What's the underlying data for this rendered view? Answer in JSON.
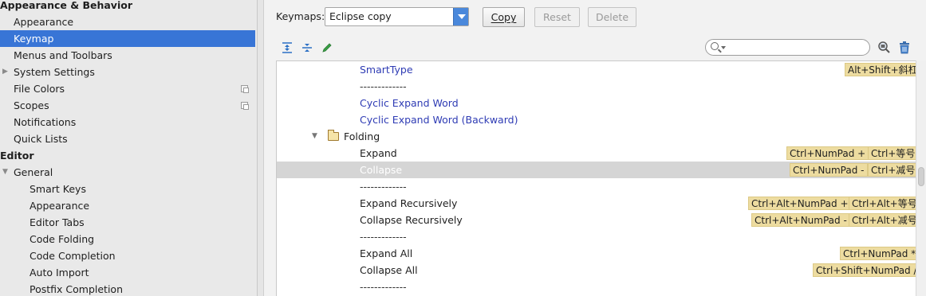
{
  "sidebar": {
    "items": [
      {
        "label": "Appearance & Behavior",
        "header": true,
        "arrow": "",
        "indent": 0,
        "copy": false
      },
      {
        "label": "Appearance",
        "header": false,
        "arrow": "",
        "indent": 17,
        "copy": false
      },
      {
        "label": "Keymap",
        "header": false,
        "arrow": "",
        "indent": 17,
        "copy": false,
        "selected": true
      },
      {
        "label": "Menus and Toolbars",
        "header": false,
        "arrow": "",
        "indent": 17,
        "copy": false
      },
      {
        "label": "System Settings",
        "header": false,
        "arrow": "▶",
        "indent": 17,
        "copy": false
      },
      {
        "label": "File Colors",
        "header": false,
        "arrow": "",
        "indent": 17,
        "copy": true
      },
      {
        "label": "Scopes",
        "header": false,
        "arrow": "",
        "indent": 17,
        "copy": true
      },
      {
        "label": "Notifications",
        "header": false,
        "arrow": "",
        "indent": 17,
        "copy": false
      },
      {
        "label": "Quick Lists",
        "header": false,
        "arrow": "",
        "indent": 17,
        "copy": false
      },
      {
        "label": "Editor",
        "header": true,
        "arrow": "",
        "indent": 0,
        "copy": false
      },
      {
        "label": "General",
        "header": false,
        "arrow": "▼",
        "indent": 17,
        "copy": false
      },
      {
        "label": "Smart Keys",
        "header": false,
        "arrow": "",
        "indent": 37,
        "copy": false
      },
      {
        "label": "Appearance",
        "header": false,
        "arrow": "",
        "indent": 37,
        "copy": false
      },
      {
        "label": "Editor Tabs",
        "header": false,
        "arrow": "",
        "indent": 37,
        "copy": false
      },
      {
        "label": "Code Folding",
        "header": false,
        "arrow": "",
        "indent": 37,
        "copy": false
      },
      {
        "label": "Code Completion",
        "header": false,
        "arrow": "",
        "indent": 37,
        "copy": false
      },
      {
        "label": "Auto Import",
        "header": false,
        "arrow": "",
        "indent": 37,
        "copy": false
      },
      {
        "label": "Postfix Completion",
        "header": false,
        "arrow": "",
        "indent": 37,
        "copy": false
      }
    ]
  },
  "toolbar": {
    "keymaps_label": "Keymaps:",
    "keymap_selected": "Eclipse copy",
    "copy_label": "Copy",
    "reset_label": "Reset",
    "delete_label": "Delete",
    "search_value": "",
    "icons": [
      "expand-all-icon",
      "collapse-all-icon",
      "edit-pencil-icon",
      "find-shortcut-icon",
      "trash-icon"
    ]
  },
  "tree": {
    "rows": [
      {
        "name": "SmartType",
        "kind": "action",
        "shortcuts": [
          "Alt+Shift+斜杠"
        ]
      },
      {
        "name": "-------------",
        "kind": "separator",
        "shortcuts": []
      },
      {
        "name": "Cyclic Expand Word",
        "kind": "action",
        "shortcuts": []
      },
      {
        "name": "Cyclic Expand Word (Backward)",
        "kind": "action",
        "shortcuts": []
      },
      {
        "name": "Folding",
        "kind": "group",
        "shortcuts": []
      },
      {
        "name": "Expand",
        "kind": "item",
        "shortcuts": [
          "Ctrl+NumPad +",
          "Ctrl+等号"
        ]
      },
      {
        "name": "Collapse",
        "kind": "item",
        "selected": true,
        "shortcuts": [
          "Ctrl+NumPad -",
          "Ctrl+减号"
        ]
      },
      {
        "name": "-------------",
        "kind": "separator",
        "shortcuts": []
      },
      {
        "name": "Expand Recursively",
        "kind": "item",
        "shortcuts": [
          "Ctrl+Alt+NumPad +",
          "Ctrl+Alt+等号"
        ]
      },
      {
        "name": "Collapse Recursively",
        "kind": "item",
        "shortcuts": [
          "Ctrl+Alt+NumPad -",
          "Ctrl+Alt+减号"
        ]
      },
      {
        "name": "-------------",
        "kind": "separator",
        "shortcuts": []
      },
      {
        "name": "Expand All",
        "kind": "item",
        "shortcuts": [
          "Ctrl+NumPad *"
        ]
      },
      {
        "name": "Collapse All",
        "kind": "item",
        "shortcuts": [
          "Ctrl+Shift+NumPad /"
        ]
      },
      {
        "name": "-------------",
        "kind": "separator",
        "shortcuts": []
      }
    ]
  },
  "colors": {
    "selection": "#3875d6",
    "action_text": "#2e3bb4",
    "shortcut_bg": "#eddca0"
  }
}
